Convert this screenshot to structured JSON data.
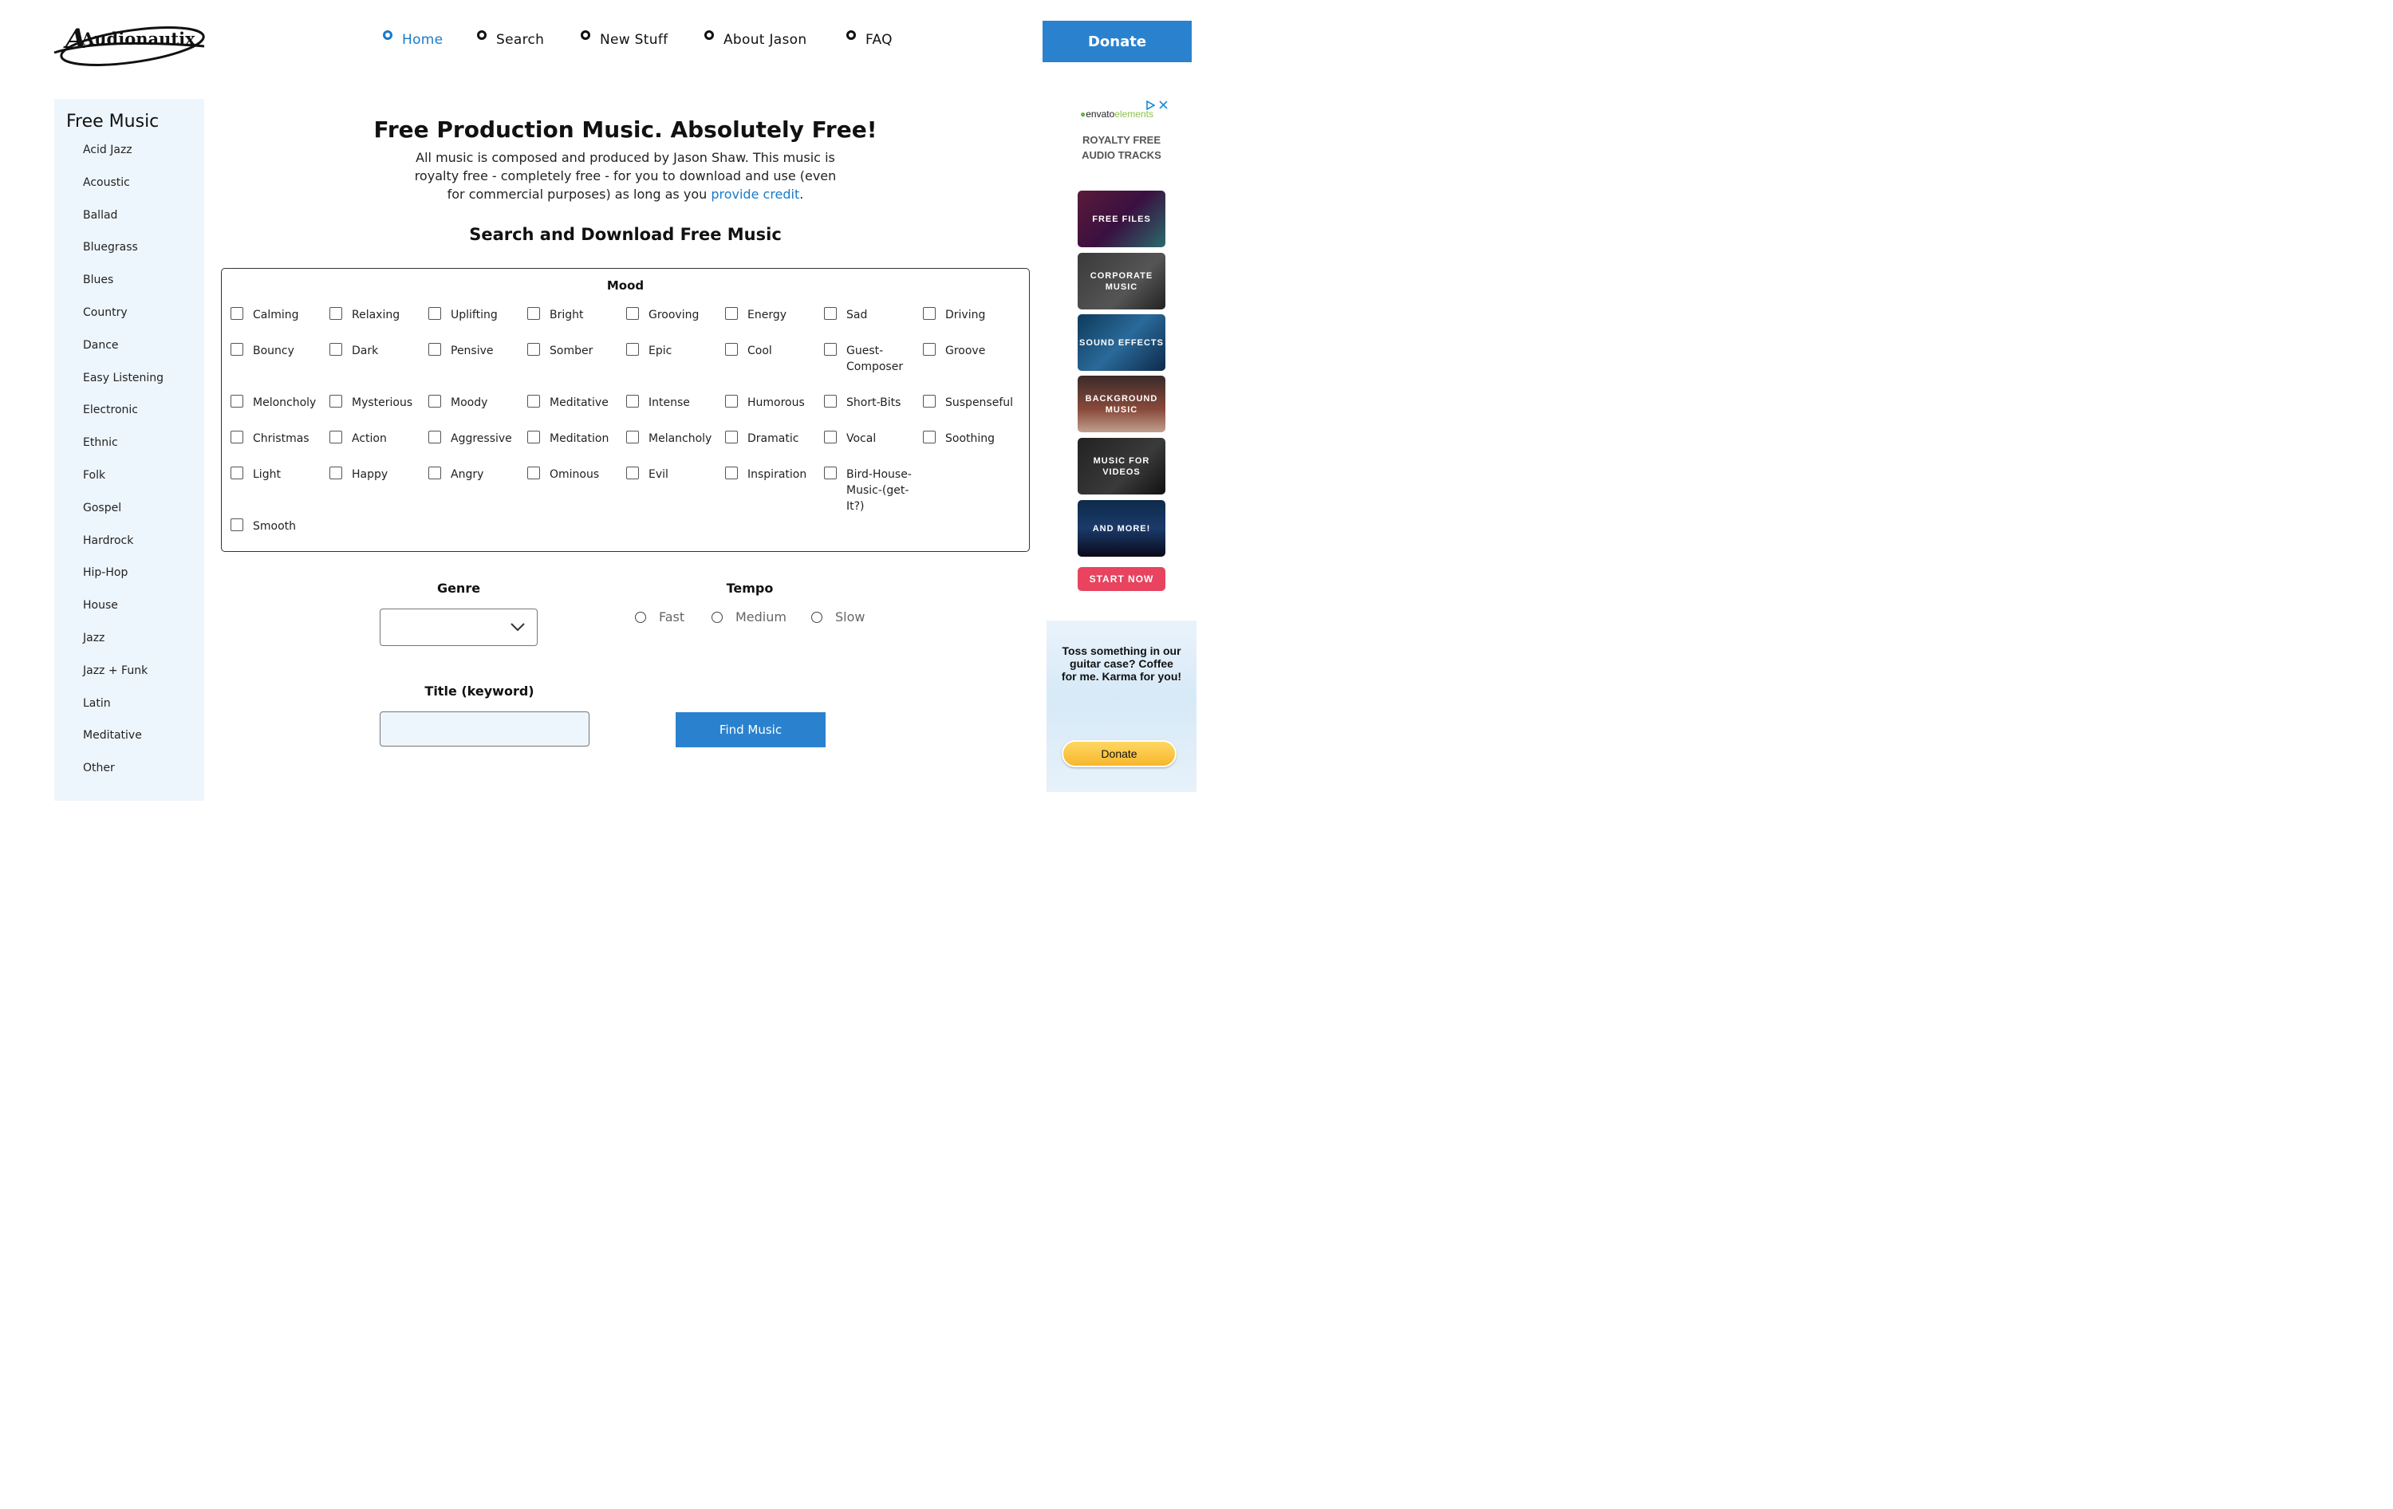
{
  "logo": {
    "text": "Audionautix"
  },
  "nav": [
    {
      "label": "Home",
      "active": true
    },
    {
      "label": "Search",
      "active": false
    },
    {
      "label": "New Stuff",
      "active": false
    },
    {
      "label": "About Jason",
      "active": false
    },
    {
      "label": "FAQ",
      "active": false
    }
  ],
  "donate_label": "Donate",
  "sidebar": {
    "title": "Free Music",
    "items": [
      "Acid Jazz",
      "Acoustic",
      "Ballad",
      "Bluegrass",
      "Blues",
      "Country",
      "Dance",
      "Easy Listening",
      "Electronic",
      "Ethnic",
      "Folk",
      "Gospel",
      "Hardrock",
      "Hip-Hop",
      "House",
      "Jazz",
      "Jazz + Funk",
      "Latin",
      "Meditative",
      "Other"
    ]
  },
  "main": {
    "title": "Free Production Music. Absolutely Free!",
    "intro_text": "All music is composed and produced by Jason Shaw. This music is royalty free - completely free - for you to download and use (even for commercial purposes) as long as you",
    "intro_link": "provide credit",
    "intro_end": ".",
    "subtitle": "Search and Download Free Music"
  },
  "mood": {
    "title": "Mood",
    "rows": [
      [
        "Calming",
        "Relaxing",
        "Uplifting",
        "Bright",
        "Grooving",
        "Energy",
        "Sad",
        "Driving"
      ],
      [
        "Bouncy",
        "Dark",
        "Pensive",
        "Somber",
        "Epic",
        "Cool",
        "Guest-Composer",
        "Groove"
      ],
      [
        "Meloncholy",
        "Mysterious",
        "Moody",
        "Meditative",
        "Intense",
        "Humorous",
        "Short-Bits",
        "Suspenseful"
      ],
      [
        "Christmas",
        "Action",
        "Aggressive",
        "Meditation",
        "Melancholy",
        "Dramatic",
        "Vocal",
        "Soothing"
      ],
      [
        "Light",
        "Happy",
        "Angry",
        "Ominous",
        "Evil",
        "Inspiration",
        "Bird-House-Music-(get-It?)"
      ],
      [
        "Smooth"
      ]
    ]
  },
  "genre": {
    "label": "Genre",
    "value": ""
  },
  "tempo": {
    "label": "Tempo",
    "options": [
      "Fast",
      "Medium",
      "Slow"
    ]
  },
  "keyword": {
    "label": "Title (keyword)",
    "value": ""
  },
  "find_button": "Find Music",
  "ad": {
    "brand_a": "envato",
    "brand_b": "elements",
    "headline": "ROYALTY FREE AUDIO TRACKS",
    "tiles": [
      "FREE FILES",
      "CORPORATE MUSIC",
      "SOUND EFFECTS",
      "BACKGROUND MUSIC",
      "MUSIC FOR VIDEOS",
      "AND MORE!"
    ],
    "cta": "START NOW"
  },
  "coffee": {
    "text": "Toss something in our guitar case? Coffee for me. Karma for you!",
    "button": "Donate"
  }
}
